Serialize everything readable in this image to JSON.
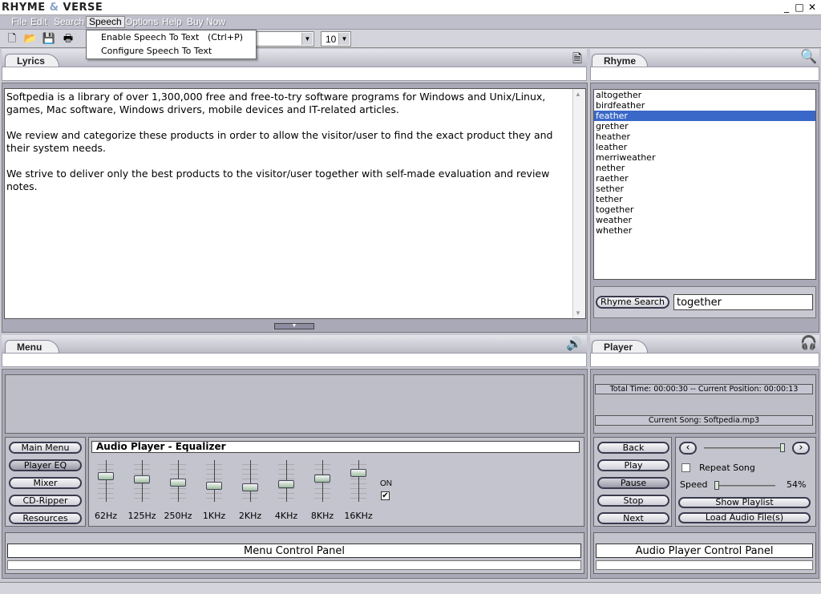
{
  "window": {
    "title_a": "RHYME",
    "title_amp": "&",
    "title_b": "VERSE",
    "min": "_",
    "max": "□",
    "close": "✕"
  },
  "menubar": {
    "items": [
      "File",
      "Edit",
      "Search",
      "Speech",
      "Options",
      "Help",
      "Buy Now"
    ]
  },
  "toolbar": {
    "font_size": "10"
  },
  "speech_menu": {
    "items": [
      {
        "label": "Enable Speech To Text",
        "shortcut": "(Ctrl+P)"
      },
      {
        "label": "Configure Speech To Text",
        "shortcut": ""
      }
    ]
  },
  "lyrics": {
    "tab": "Lyrics",
    "paragraphs": [
      "Softpedia is a library of over 1,300,000 free and free-to-try software programs for Windows and Unix/Linux, games, Mac software, Windows drivers, mobile devices and IT-related articles.",
      "We review and categorize these products in order to allow the visitor/user to find the exact product they and their system needs.",
      "We strive to deliver only the best products to the visitor/user together with self-made evaluation and review notes."
    ]
  },
  "rhyme": {
    "tab": "Rhyme",
    "words": [
      "altogether",
      "birdfeather",
      "feather",
      "grether",
      "heather",
      "leather",
      "merriweather",
      "nether",
      "raether",
      "sether",
      "tether",
      "together",
      "weather",
      "whether"
    ],
    "selected_index": 2,
    "search_button": "Rhyme Search",
    "search_value": "together"
  },
  "menu_panel": {
    "tab": "Menu",
    "buttons": [
      "Main Menu",
      "Player EQ",
      "Mixer",
      "CD-Ripper",
      "Resources"
    ],
    "active_button": 1,
    "eq_title": "Audio Player - Equalizer",
    "bands": [
      {
        "label": "62Hz",
        "level": 0.35
      },
      {
        "label": "125Hz",
        "level": 0.45
      },
      {
        "label": "250Hz",
        "level": 0.55
      },
      {
        "label": "1KHz",
        "level": 0.65
      },
      {
        "label": "2KHz",
        "level": 0.68
      },
      {
        "label": "4KHz",
        "level": 0.6
      },
      {
        "label": "8KHz",
        "level": 0.42
      },
      {
        "label": "16KHz",
        "level": 0.25
      }
    ],
    "on_label": "ON",
    "on_checked": true,
    "control_panel": "Menu Control Panel"
  },
  "player_panel": {
    "tab": "Player",
    "time_info": "Total Time: 00:00:30 -- Current Position: 00:00:13",
    "current_song": "Current Song: Softpedia.mp3",
    "buttons": [
      "Back",
      "Play",
      "Pause",
      "Stop",
      "Next"
    ],
    "active_button": 2,
    "prev_icon": "‹",
    "next_icon": "›",
    "repeat_label": "Repeat Song",
    "speed_label": "Speed",
    "speed_value": "54%",
    "show_playlist": "Show Playlist",
    "load_audio": "Load Audio File(s)",
    "control_panel": "Audio Player Control Panel"
  },
  "icons": {
    "new": "new-document-icon",
    "open": "open-folder-icon",
    "save": "save-icon",
    "print": "print-icon",
    "page": "page-icon",
    "search": "magnifier-icon",
    "speaker": "speaker-icon",
    "headphones": "headphones-icon"
  }
}
